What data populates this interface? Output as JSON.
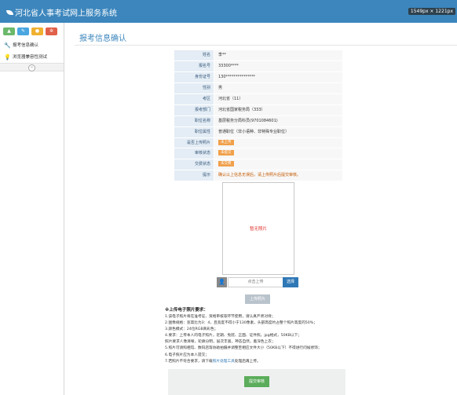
{
  "header": {
    "title": "河北省人事考试网上服务系统",
    "dim_tip": "1549px × 1221px",
    "color": "#3c86bd"
  },
  "sidebar": {
    "quick_buttons": [
      {
        "icon": "chart-icon",
        "symbol": "▲",
        "color": "#6bb86b"
      },
      {
        "icon": "pencil-icon",
        "symbol": "✎",
        "color": "#4aa6e0"
      },
      {
        "icon": "user-icon",
        "symbol": "●",
        "color": "#f0b030"
      },
      {
        "icon": "gear-icon",
        "symbol": "✲",
        "color": "#e0604a"
      }
    ],
    "items": [
      {
        "label": "报考信息确认",
        "icon": "wrench-icon",
        "symbol": "🔧"
      },
      {
        "label": "浏览器兼容性测试",
        "icon": "lightbulb-icon",
        "symbol": "💡"
      }
    ],
    "collapse_symbol": "«"
  },
  "page_title": "报考信息确认",
  "info": {
    "rows": [
      {
        "label": "姓名",
        "value": "李**"
      },
      {
        "label": "报名号",
        "value": "33300****"
      },
      {
        "label": "身份证号",
        "value": "130***************"
      },
      {
        "label": "性别",
        "value": "男"
      },
      {
        "label": "考区",
        "value": "河北省（11）"
      },
      {
        "label": "报考部门",
        "value": "河北省国家税务局（333）"
      },
      {
        "label": "职位名称",
        "value": "基层税务分局科员(9701084601)"
      },
      {
        "label": "职位属性",
        "value": "普通职位（非小语种、非特殊专业职位）"
      },
      {
        "label": "是否上传照片",
        "badge": "未上传"
      },
      {
        "label": "审核状态",
        "badge": "未提交"
      },
      {
        "label": "交费状态",
        "badge": "未交费"
      },
      {
        "label": "提示",
        "hint": "确认以上信息无误后，请上传照片后提交审核。"
      }
    ]
  },
  "photo": {
    "placeholder": "暂无照片"
  },
  "upload": {
    "placeholder": "点击上传",
    "choose_label": "选择",
    "upload_label": "上传照片"
  },
  "requirements": {
    "title": "※上传电子照片要求：",
    "lines": [
      "1.该电子照片将在准考证、资格审核等环节使用，请认真严肃对待；",
      "2.图像规格：宽高比为3：4，且宽度不得小于130像素，头部高度约占整个照片高度的50%；",
      "3.颜色模式：24位RGB真彩色；",
      "4.要求：上传本人的电子照片，近期、免冠、正面、证件照，jpg格式，50KB以下；",
      "照片要求人像清晰，轮廓分明，层次丰富，神态自然，着深色上衣；",
      "5.照片可请照相馆、数码店等协助拍摄并调整至相应文件大小（50KB以下）不得进行问候修饰；",
      "6.电子照片应为本人提交；"
    ],
    "last_prefix": "7.若照片不符合要求，请下载",
    "last_link": "照片处理工具",
    "last_suffix": "处理后再上传。"
  },
  "submit_label": "提交审核"
}
